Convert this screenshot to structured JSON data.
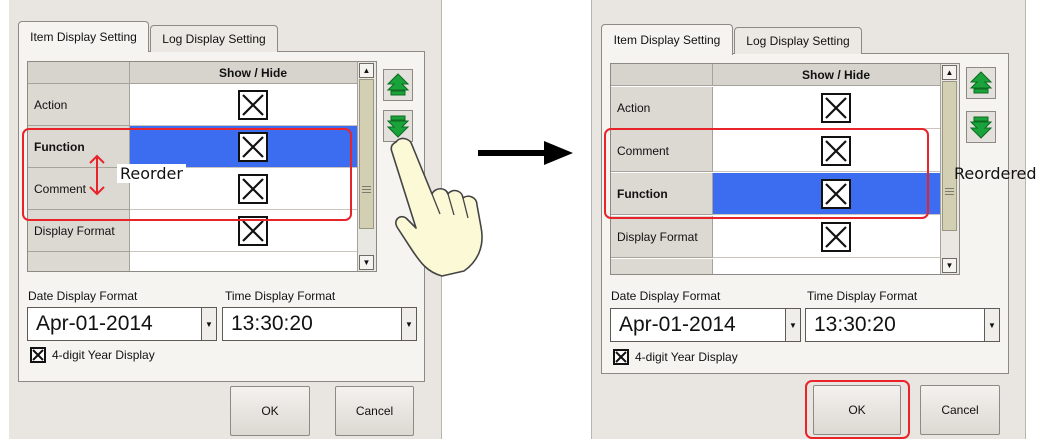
{
  "left": {
    "tabs": [
      {
        "label": "Item Display Setting",
        "active": true
      },
      {
        "label": "Log Display Setting",
        "active": false
      }
    ],
    "column_header": "Show / Hide",
    "rows": [
      {
        "label": "Action",
        "checked": true,
        "selected": false
      },
      {
        "label": "Function",
        "checked": true,
        "selected": true
      },
      {
        "label": "Comment",
        "checked": true,
        "selected": false
      },
      {
        "label": "Display Format",
        "checked": true,
        "selected": false
      }
    ],
    "date_label": "Date Display Format",
    "time_label": "Time Display Format",
    "date_value": "Apr-01-2014",
    "time_value": "13:30:20",
    "year_checkbox_label": "4-digit Year Display",
    "ok_label": "OK",
    "cancel_label": "Cancel",
    "annotation": "Reorder"
  },
  "right": {
    "tabs": [
      {
        "label": "Item Display Setting",
        "active": true
      },
      {
        "label": "Log Display Setting",
        "active": false
      }
    ],
    "column_header": "Show / Hide",
    "rows": [
      {
        "label": "Action",
        "checked": true,
        "selected": false
      },
      {
        "label": "Comment",
        "checked": true,
        "selected": false
      },
      {
        "label": "Function",
        "checked": true,
        "selected": true
      },
      {
        "label": "Display Format",
        "checked": true,
        "selected": false
      }
    ],
    "date_label": "Date Display Format",
    "time_label": "Time Display Format",
    "date_value": "Apr-01-2014",
    "time_value": "13:30:20",
    "year_checkbox_label": "4-digit Year Display",
    "ok_label": "OK",
    "cancel_label": "Cancel",
    "annotation": "Reordered"
  },
  "colors": {
    "selection": "#3c6df0",
    "highlight": "#e8232a",
    "arrow_green": "#1aa33a",
    "panel": "#e9e6e1"
  },
  "icons": [
    "move-up-icon",
    "move-down-icon",
    "hand-pointer-icon",
    "right-arrow-icon",
    "reorder-arrow-icon",
    "x-mark-icon"
  ]
}
